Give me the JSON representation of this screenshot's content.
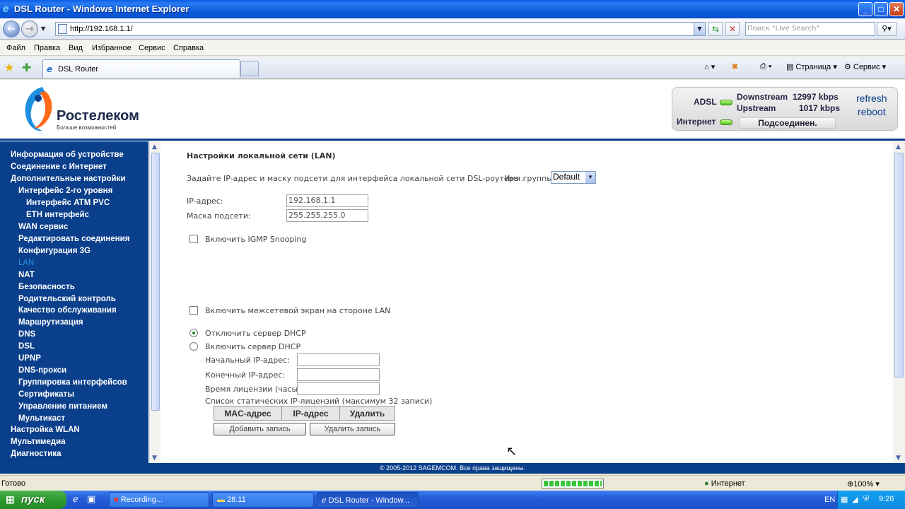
{
  "window": {
    "title": "DSL Router - Windows Internet Explorer",
    "minimize": "_",
    "maximize": "□",
    "close": "✕"
  },
  "addressbar": {
    "url": "http://192.168.1.1/",
    "search_placeholder": "Поиск \"Live Search\""
  },
  "menu": [
    "Файл",
    "Правка",
    "Вид",
    "Избранное",
    "Сервис",
    "Справка"
  ],
  "tab": {
    "label": "DSL Router"
  },
  "toolbar": {
    "page": "Страница",
    "tools": "Сервис"
  },
  "brand": {
    "name": "Ростелеком",
    "slogan": "Больше возможностей",
    "color": "#0a3f8c"
  },
  "status": {
    "adsl_label": "ADSL",
    "downstream_label": "Downstream",
    "downstream_value": "12997 kbps",
    "upstream_label": "Upstream",
    "upstream_value": "1017 kbps",
    "internet_label": "Интернет",
    "connection": "Подсоединен.",
    "refresh": "refresh",
    "reboot": "reboot"
  },
  "sidebar": {
    "items": [
      "Информация об устройстве",
      "Соединение с Интернет",
      "Дополнительные настройки",
      "Интерфейс 2-го уровня",
      "Интерфейс ATM PVC",
      "ETH интерфейс",
      "WAN сервис",
      "Редактировать соединения",
      "Конфигурация 3G",
      "LAN",
      "NAT",
      "Безопасность",
      "Родительский контроль",
      "Качество обслуживания",
      "Маршрутизация",
      "DNS",
      "DSL",
      "UPNP",
      "DNS-прокси",
      "Группировка интерфейсов",
      "Сертификаты",
      "Управление питанием",
      "Мультикаст",
      "Настройка WLAN",
      "Мультимедиа",
      "Диагностика"
    ]
  },
  "content": {
    "title": "Настройки локальной сети (LAN)",
    "description": "Задайте IP-адрес и маску подсети для интерфейса локальной сети DSL-роутера .",
    "group_label": "Имя группы",
    "group_value": "Default",
    "ip_label": "IP-адрес:",
    "ip_value": "192.168.1.1",
    "mask_label": "Маска подсети:",
    "mask_value": "255.255.255.0",
    "igmp_label": "Включить IGMP Snooping",
    "firewall_label": "Включить межсетевой экран на стороне LAN",
    "dhcp_off_label": "Отключить сервер DHCP",
    "dhcp_on_label": "Включить сервер DHCP",
    "start_ip_label": "Начальный IP-адрес:",
    "end_ip_label": "Конечный IP-адрес:",
    "lease_label": "Время лицензии (часы):",
    "static_list_label": "Список статических IP-лицензий (максимум 32 записи)",
    "table_headers": [
      "MAC-адрес",
      "IP-адрес",
      "Удалить"
    ],
    "add_button": "Добавить запись",
    "remove_button": "Удалить запись"
  },
  "footer": "© 2005-2012 SAGEMCOM. Все права защищены.",
  "statusbar": {
    "ready": "Готово",
    "progress": 1.0,
    "zone": "Интернет",
    "zoom": "100%"
  },
  "taskbar": {
    "start": "пуск",
    "buttons": [
      "Recording...",
      "28.11",
      "DSL Router - Window..."
    ],
    "lang": "EN",
    "time": "9:26"
  }
}
